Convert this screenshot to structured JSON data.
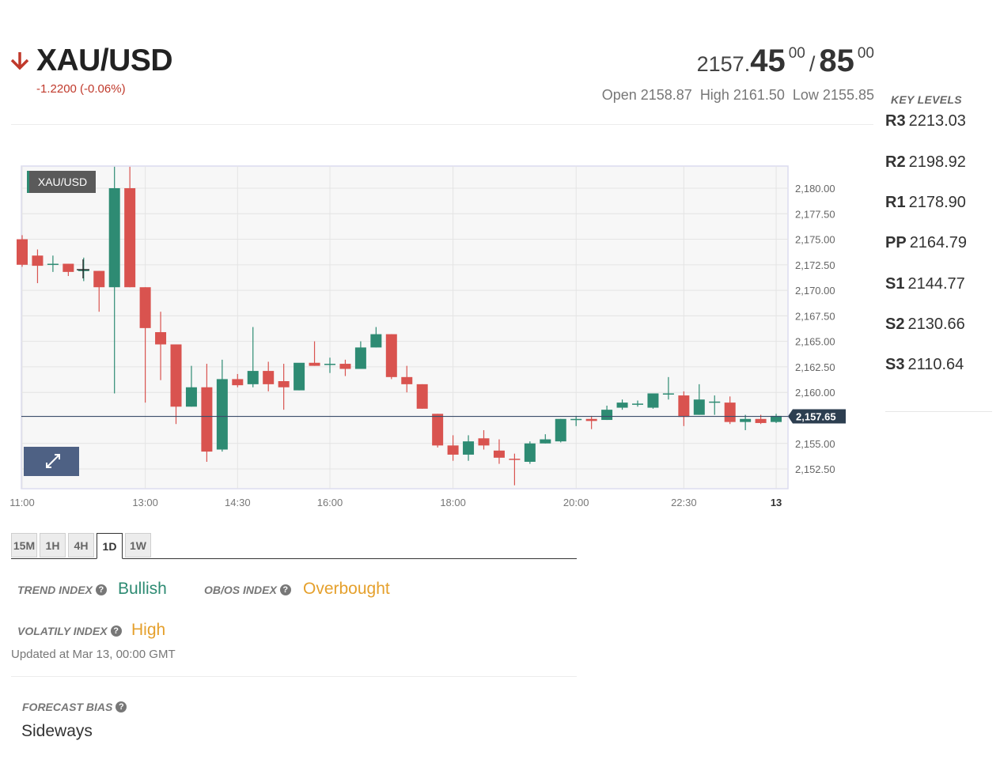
{
  "header": {
    "symbol": "XAU/USD",
    "change": "-1.2200 (-0.06%)",
    "bid_prefix": "2157.",
    "bid_big": "45",
    "bid_sup": "00",
    "ask_big": "85",
    "ask_sup": "00",
    "slash": "/",
    "open": "Open 2158.87",
    "high": "High 2161.50",
    "low": "Low 2155.85",
    "direction_icon": "arrow-down-icon"
  },
  "key_levels": {
    "title": "KEY LEVELS",
    "items": [
      {
        "name": "R3",
        "value": "2213.03"
      },
      {
        "name": "R2",
        "value": "2198.92"
      },
      {
        "name": "R1",
        "value": "2178.90"
      },
      {
        "name": "PP",
        "value": "2164.79"
      },
      {
        "name": "S1",
        "value": "2144.77"
      },
      {
        "name": "S2",
        "value": "2130.66"
      },
      {
        "name": "S3",
        "value": "2110.64"
      }
    ]
  },
  "colors": {
    "up": "#2e8b73",
    "down": "#d9534f",
    "change": "#c0392b",
    "price_tag": "#2c3e50"
  },
  "chart_data": {
    "type": "candlestick",
    "legend": "XAU/USD",
    "ylim": [
      2150.8,
      2182.2
    ],
    "y_ticks": [
      "2,180.00",
      "2,177.50",
      "2,175.00",
      "2,172.50",
      "2,170.00",
      "2,167.50",
      "2,165.00",
      "2,162.50",
      "2,160.00",
      "2,155.00",
      "2,152.50"
    ],
    "y_tick_values": [
      2180,
      2177.5,
      2175,
      2172.5,
      2170,
      2167.5,
      2165,
      2162.5,
      2160,
      2155,
      2152.5
    ],
    "x_ticks": [
      "11:00",
      "13:00",
      "14:30",
      "16:00",
      "18:00",
      "20:00",
      "22:30",
      "13"
    ],
    "x_tick_index": [
      0,
      8,
      14,
      20,
      28,
      36,
      43,
      49
    ],
    "current_price": 2157.65,
    "current_price_label": "2,157.65",
    "candles": [
      {
        "o": 2175.0,
        "h": 2175.4,
        "c": 2172.5,
        "l": 2172.3
      },
      {
        "o": 2173.4,
        "h": 2174.0,
        "c": 2172.4,
        "l": 2170.7
      },
      {
        "o": 2172.6,
        "h": 2173.4,
        "c": 2172.6,
        "l": 2171.8
      },
      {
        "o": 2172.6,
        "h": 2172.6,
        "c": 2171.8,
        "l": 2171.4
      },
      {
        "o": 2172.0,
        "h": 2173.2,
        "c": 2172.0,
        "l": 2170.9
      },
      {
        "o": 2171.9,
        "h": 2171.9,
        "c": 2170.3,
        "l": 2167.9
      },
      {
        "o": 2170.3,
        "h": 2182.1,
        "c": 2180.0,
        "l": 2159.9
      },
      {
        "o": 2180.0,
        "h": 2182.1,
        "c": 2170.3,
        "l": 2170.3
      },
      {
        "o": 2170.3,
        "h": 2170.3,
        "c": 2166.3,
        "l": 2159.0
      },
      {
        "o": 2165.9,
        "h": 2167.9,
        "c": 2164.7,
        "l": 2161.2
      },
      {
        "o": 2164.7,
        "h": 2164.7,
        "c": 2158.6,
        "l": 2156.9
      },
      {
        "o": 2158.6,
        "h": 2162.6,
        "c": 2160.5,
        "l": 2158.6
      },
      {
        "o": 2160.5,
        "h": 2162.8,
        "c": 2154.2,
        "l": 2153.2
      },
      {
        "o": 2154.4,
        "h": 2163.2,
        "c": 2161.3,
        "l": 2154.2
      },
      {
        "o": 2161.3,
        "h": 2161.8,
        "c": 2160.7,
        "l": 2160.5
      },
      {
        "o": 2160.8,
        "h": 2166.4,
        "c": 2162.1,
        "l": 2160.5
      },
      {
        "o": 2162.1,
        "h": 2163.0,
        "c": 2160.8,
        "l": 2160.1
      },
      {
        "o": 2161.1,
        "h": 2162.8,
        "c": 2160.5,
        "l": 2158.3
      },
      {
        "o": 2160.2,
        "h": 2162.6,
        "c": 2162.9,
        "l": 2160.2
      },
      {
        "o": 2162.9,
        "h": 2165.0,
        "c": 2162.6,
        "l": 2162.6
      },
      {
        "o": 2162.8,
        "h": 2163.4,
        "c": 2162.8,
        "l": 2161.9
      },
      {
        "o": 2162.8,
        "h": 2163.2,
        "c": 2162.3,
        "l": 2161.6
      },
      {
        "o": 2162.3,
        "h": 2165.0,
        "c": 2164.4,
        "l": 2162.3
      },
      {
        "o": 2164.4,
        "h": 2166.4,
        "c": 2165.7,
        "l": 2164.4
      },
      {
        "o": 2165.7,
        "h": 2165.7,
        "c": 2161.5,
        "l": 2161.3
      },
      {
        "o": 2161.5,
        "h": 2162.6,
        "c": 2160.8,
        "l": 2160.0
      },
      {
        "o": 2160.8,
        "h": 2160.8,
        "c": 2158.4,
        "l": 2158.4
      },
      {
        "o": 2157.9,
        "h": 2157.9,
        "c": 2154.8,
        "l": 2154.6
      },
      {
        "o": 2154.8,
        "h": 2155.8,
        "c": 2153.9,
        "l": 2153.3
      },
      {
        "o": 2153.9,
        "h": 2155.8,
        "c": 2155.2,
        "l": 2153.3
      },
      {
        "o": 2155.5,
        "h": 2156.3,
        "c": 2154.8,
        "l": 2154.4
      },
      {
        "o": 2154.3,
        "h": 2155.4,
        "c": 2153.6,
        "l": 2153.0
      },
      {
        "o": 2153.5,
        "h": 2154.0,
        "c": 2153.4,
        "l": 2150.9
      },
      {
        "o": 2153.2,
        "h": 2155.2,
        "c": 2155.0,
        "l": 2153.0
      },
      {
        "o": 2155.0,
        "h": 2155.9,
        "c": 2155.4,
        "l": 2155.0
      },
      {
        "o": 2155.2,
        "h": 2157.4,
        "c": 2157.4,
        "l": 2155.1
      },
      {
        "o": 2157.4,
        "h": 2157.7,
        "c": 2157.4,
        "l": 2156.7
      },
      {
        "o": 2157.4,
        "h": 2157.7,
        "c": 2157.2,
        "l": 2156.4
      },
      {
        "o": 2157.3,
        "h": 2158.7,
        "c": 2158.3,
        "l": 2157.3
      },
      {
        "o": 2158.5,
        "h": 2159.3,
        "c": 2159.0,
        "l": 2158.3
      },
      {
        "o": 2158.9,
        "h": 2159.2,
        "c": 2158.9,
        "l": 2158.6
      },
      {
        "o": 2158.5,
        "h": 2159.9,
        "c": 2159.9,
        "l": 2158.4
      },
      {
        "o": 2159.9,
        "h": 2161.5,
        "c": 2159.9,
        "l": 2159.3
      },
      {
        "o": 2159.7,
        "h": 2160.1,
        "c": 2157.6,
        "l": 2156.7
      },
      {
        "o": 2157.8,
        "h": 2160.8,
        "c": 2159.3,
        "l": 2157.8
      },
      {
        "o": 2159.1,
        "h": 2159.7,
        "c": 2159.1,
        "l": 2157.8
      },
      {
        "o": 2159.0,
        "h": 2159.6,
        "c": 2157.1,
        "l": 2156.9
      },
      {
        "o": 2157.1,
        "h": 2157.8,
        "c": 2157.4,
        "l": 2156.3
      },
      {
        "o": 2157.4,
        "h": 2157.8,
        "c": 2157.0,
        "l": 2156.9
      },
      {
        "o": 2157.1,
        "h": 2157.9,
        "c": 2157.7,
        "l": 2157.0
      }
    ]
  },
  "timeframe_tabs": [
    {
      "label": "15M",
      "active": false
    },
    {
      "label": "1H",
      "active": false
    },
    {
      "label": "4H",
      "active": false
    },
    {
      "label": "1D",
      "active": true
    },
    {
      "label": "1W",
      "active": false
    }
  ],
  "indicators": {
    "trend_label": "TREND INDEX",
    "trend_value": "Bullish",
    "obos_label": "OB/OS INDEX",
    "obos_value": "Overbought",
    "volatility_label": "VOLATILY INDEX",
    "volatility_value": "High",
    "help_glyph": "?",
    "updated": "Updated at Mar 13, 00:00 GMT"
  },
  "forecast": {
    "label": "FORECAST BIAS",
    "value": "Sideways"
  }
}
